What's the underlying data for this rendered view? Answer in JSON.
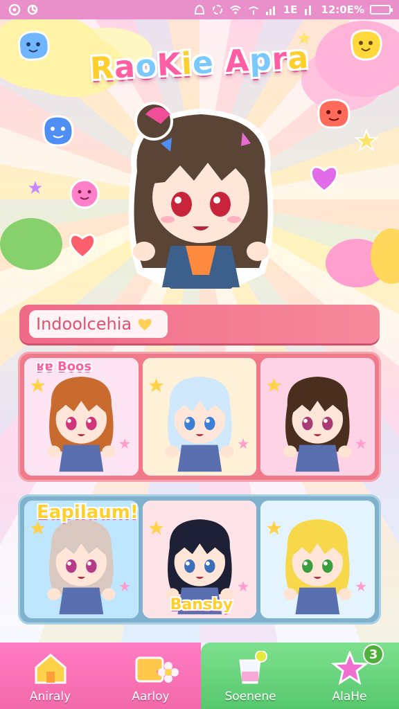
{
  "status_bar": {
    "time": "12:0E%",
    "signal_text": "1E"
  },
  "app": {
    "title_letters": [
      "R",
      "a",
      "o",
      "K",
      "i",
      "e",
      " ",
      "A",
      "p",
      "r",
      "a"
    ]
  },
  "profile": {
    "name": "Indoolcehia"
  },
  "character_rows": [
    {
      "tag": "ʁɐ Boos",
      "cards": [
        {
          "hair": "#c96b2e",
          "bg": "#fde4f2",
          "eyes": "#d2347a"
        },
        {
          "hair": "#cfe8fb",
          "bg": "#fff1d8",
          "eyes": "#3b7fd8"
        },
        {
          "hair": "#4a2e1e",
          "bg": "#ffd3e6",
          "eyes": "#a83a74"
        }
      ]
    },
    {
      "tag": "Eapilaum!",
      "cards": [
        {
          "hair": "#d9c8bf",
          "bg": "#bfe6ff",
          "eyes": "#b63a86"
        },
        {
          "hair": "#1e2036",
          "bg": "#fde2e8",
          "eyes": "#3b6fb8"
        },
        {
          "hair": "#f7d84b",
          "bg": "#e4f4ff",
          "eyes": "#3a9d3e"
        }
      ]
    }
  ],
  "card_caption": "Bansby",
  "nav": [
    {
      "label": "Aniraly",
      "icon": "house-icon"
    },
    {
      "label": "Aarloy",
      "icon": "folder-icon"
    },
    {
      "label": "Soenene",
      "icon": "cup-icon"
    },
    {
      "label": "AlaHe",
      "icon": "star-icon",
      "badge": "3"
    }
  ]
}
